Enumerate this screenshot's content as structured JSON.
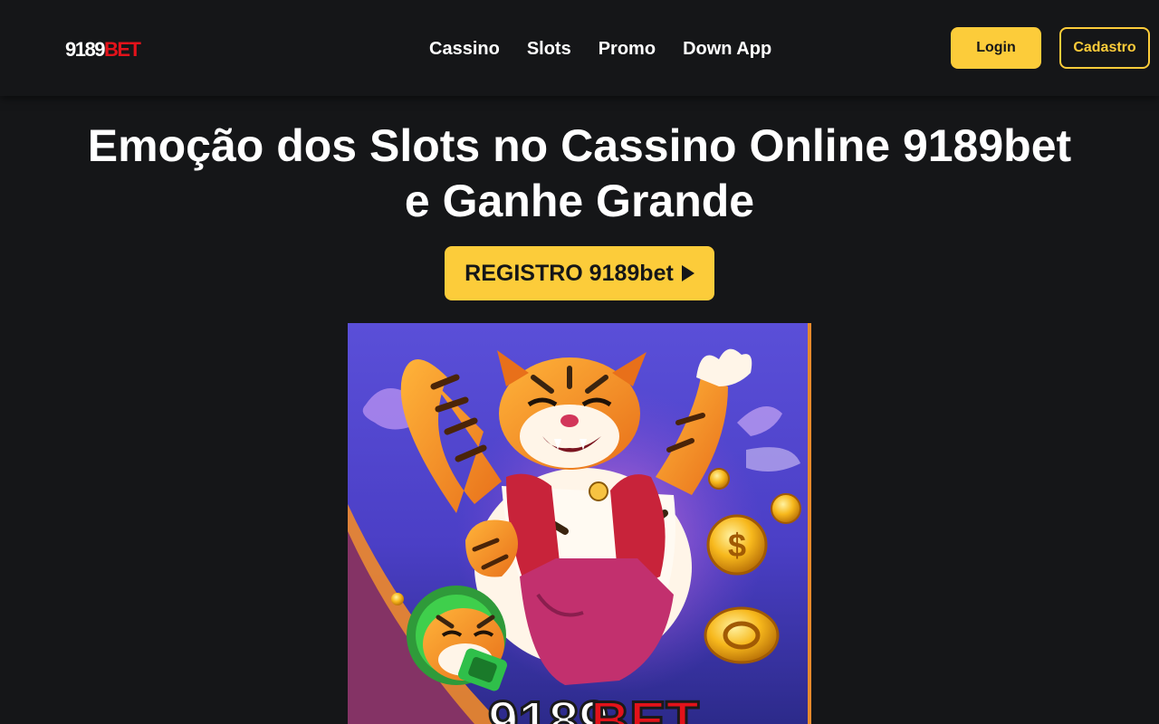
{
  "header": {
    "logo": {
      "number": "9189",
      "suffix": "BET"
    },
    "nav": [
      {
        "label": "Cassino"
      },
      {
        "label": "Slots"
      },
      {
        "label": "Promo"
      },
      {
        "label": "Down App"
      }
    ],
    "login_label": "Login",
    "cadastro_label": "Cadastro"
  },
  "hero": {
    "title": "Emoção dos Slots no Cassino Online 9189bet e Ganhe Grande",
    "cta_label": "REGISTRO 9189bet"
  },
  "banner": {
    "image_name": "fortune-tiger-banner-image"
  },
  "colors": {
    "background": "#151618",
    "accent": "#fccc3a",
    "logo_red": "#e3121a"
  }
}
